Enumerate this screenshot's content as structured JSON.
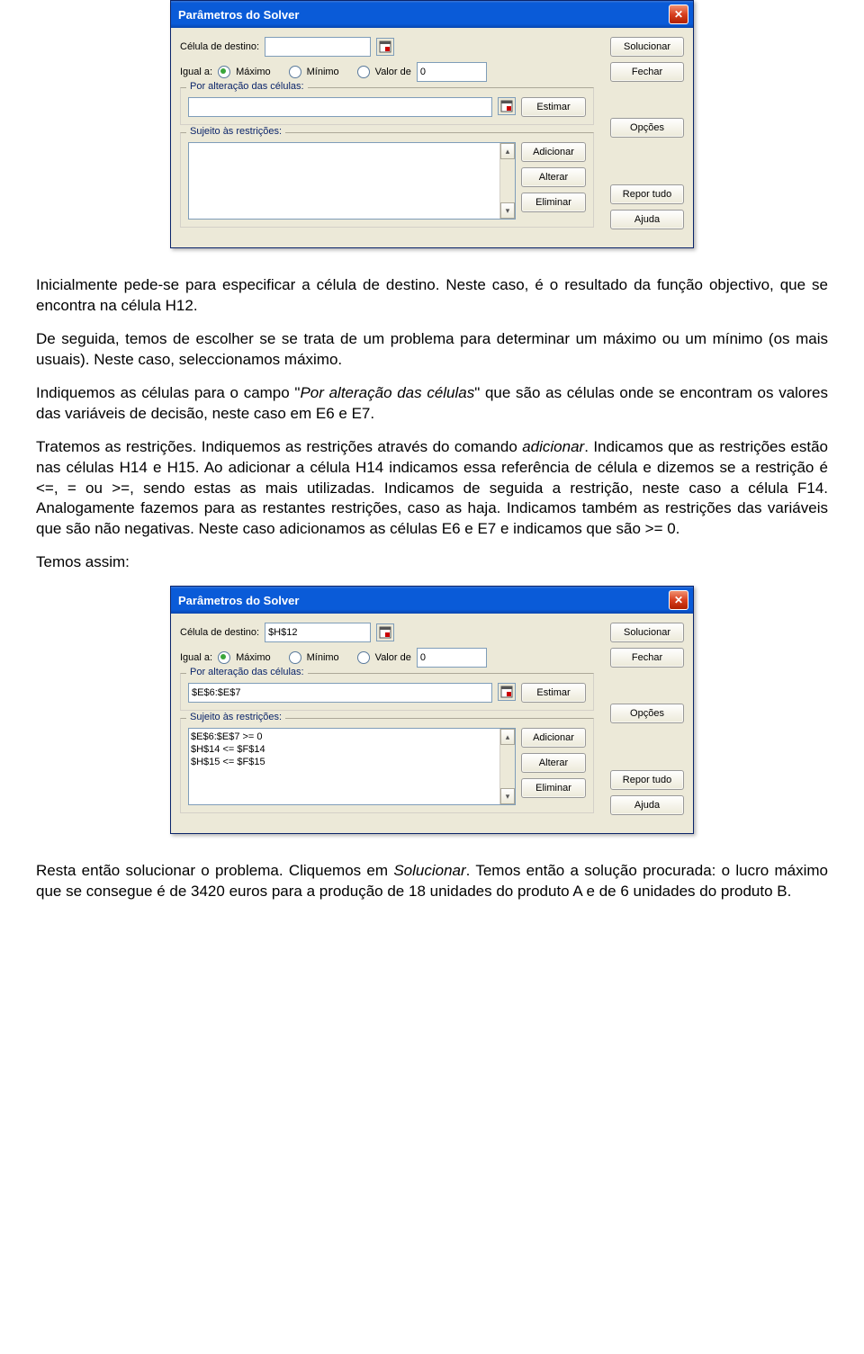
{
  "dialog1": {
    "title": "Parâmetros do Solver",
    "target_label": "Célula de destino:",
    "target_value": "",
    "equal_label": "Igual a:",
    "opt_max": "Máximo",
    "opt_min": "Mínimo",
    "opt_val": "Valor de",
    "val_input": "0",
    "change_legend": "Por alteração das células:",
    "change_value": "",
    "estimate": "Estimar",
    "constraints_legend": "Sujeito às restrições:",
    "constraints": [],
    "add": "Adicionar",
    "change": "Alterar",
    "delete": "Eliminar",
    "solve": "Solucionar",
    "close": "Fechar",
    "options": "Opções",
    "reset": "Repor tudo",
    "help": "Ajuda"
  },
  "dialog2": {
    "title": "Parâmetros do Solver",
    "target_label": "Célula de destino:",
    "target_value": "$H$12",
    "equal_label": "Igual a:",
    "opt_max": "Máximo",
    "opt_min": "Mínimo",
    "opt_val": "Valor de",
    "val_input": "0",
    "change_legend": "Por alteração das células:",
    "change_value": "$E$6:$E$7",
    "estimate": "Estimar",
    "constraints_legend": "Sujeito às restrições:",
    "constraints": [
      "$E$6:$E$7 >= 0",
      "$H$14 <= $F$14",
      "$H$15 <= $F$15"
    ],
    "add": "Adicionar",
    "change": "Alterar",
    "delete": "Eliminar",
    "solve": "Solucionar",
    "close": "Fechar",
    "options": "Opções",
    "reset": "Repor tudo",
    "help": "Ajuda"
  },
  "text": {
    "p1": "Inicialmente pede-se para especificar a célula de destino. Neste caso, é o resultado da função objectivo, que se encontra na célula H12.",
    "p2": "De seguida, temos de escolher se se trata de um problema para determinar um máximo ou um mínimo (os mais usuais). Neste caso, seleccionamos máximo.",
    "p3a": "Indiquemos as células para o campo \"",
    "p3i": "Por alteração das células",
    "p3b": "\" que são as células onde se encontram os valores das variáveis de decisão, neste caso em E6 e E7.",
    "p4a": "Tratemos as restrições. Indiquemos as restrições através do comando ",
    "p4i1": "adicionar",
    "p4b": ". Indicamos que as restrições estão nas células H14 e H15. Ao adicionar a célula H14 indicamos essa referência de célula e dizemos se a restrição é <=, = ou >=, sendo estas as mais utilizadas. Indicamos de seguida a restrição, neste caso a célula F14. Analogamente fazemos para as restantes restrições, caso as haja. Indicamos também as restrições das variáveis que são não negativas. Neste caso adicionamos as células E6 e E7 e indicamos que são >= 0.",
    "p5": "Temos assim:",
    "p6a": "Resta então solucionar o problema. Cliquemos em ",
    "p6i": "Solucionar",
    "p6b": ". Temos então a solução procurada: o lucro máximo que se consegue é de 3420 euros para a produção de 18 unidades do produto A e de 6 unidades do produto B."
  }
}
